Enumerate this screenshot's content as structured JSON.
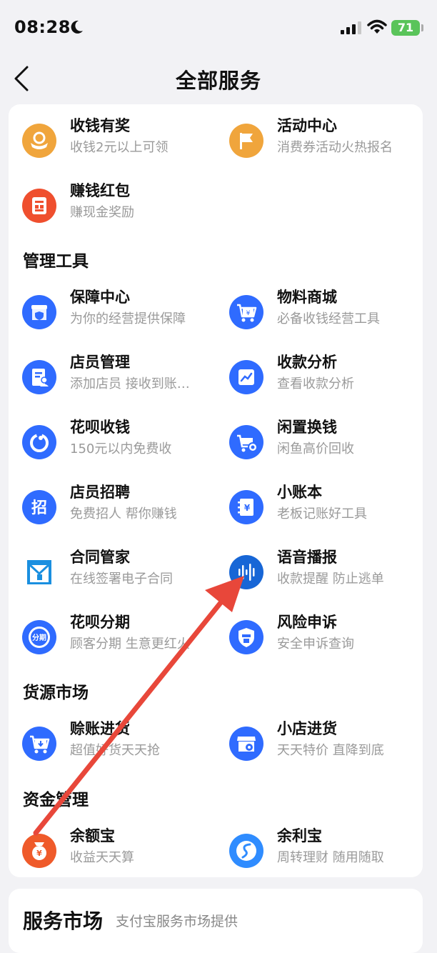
{
  "status": {
    "time": "08:28",
    "battery": "71"
  },
  "nav": {
    "title": "全部服务"
  },
  "sections": {
    "management": "管理工具",
    "goods": "货源市场",
    "funds": "资金管理"
  },
  "items": {
    "shouqian_youjiang": {
      "title": "收钱有奖",
      "sub": "收钱2元以上可领"
    },
    "huodong_zhongxin": {
      "title": "活动中心",
      "sub": "消费券活动火热报名"
    },
    "zhuanqian_hongbao": {
      "title": "赚钱红包",
      "sub": "赚现金奖励"
    },
    "baozhang_zhongxin": {
      "title": "保障中心",
      "sub": "为你的经营提供保障"
    },
    "wuliao_shangcheng": {
      "title": "物料商城",
      "sub": "必备收钱经营工具"
    },
    "dianyuan_guanli": {
      "title": "店员管理",
      "sub": "添加店员 接收到账…"
    },
    "shoukuan_fenxi": {
      "title": "收款分析",
      "sub": "查看收款分析"
    },
    "huabei_shouqian": {
      "title": "花呗收钱",
      "sub": "150元以内免费收"
    },
    "xianzhi_huanqian": {
      "title": "闲置换钱",
      "sub": "闲鱼高价回收"
    },
    "dianyuan_zhaopin": {
      "title": "店员招聘",
      "sub": "免费招人 帮你赚钱"
    },
    "xiao_zhangben": {
      "title": "小账本",
      "sub": "老板记账好工具"
    },
    "hetong_guanjia": {
      "title": "合同管家",
      "sub": "在线签署电子合同"
    },
    "yuyin_bobao": {
      "title": "语音播报",
      "sub": "收款提醒 防止逃单"
    },
    "huabei_fenqi": {
      "title": "花呗分期",
      "sub": "顾客分期 生意更红火"
    },
    "fengxian_shensu": {
      "title": "风险申诉",
      "sub": "安全申诉查询"
    },
    "shezhang_jinhuo": {
      "title": "赊账进货",
      "sub": "超值好货天天抢"
    },
    "xiaodian_jinhuo": {
      "title": "小店进货",
      "sub": "天天特价 直降到底"
    },
    "yuebao": {
      "title": "余额宝",
      "sub": "收益天天算"
    },
    "yulibao": {
      "title": "余利宝",
      "sub": "周转理财 随用随取"
    }
  },
  "icon_glyphs": {
    "zhao": "招",
    "fenqi": "分期",
    "yen": "¥"
  },
  "market": {
    "title": "服务市场",
    "sub": "支付宝服务市场提供"
  },
  "colors": {
    "blue": "#2f6bff",
    "orange": "#f0a53c",
    "red": "#ef4f2e",
    "annotation_arrow": "#e8473a"
  }
}
